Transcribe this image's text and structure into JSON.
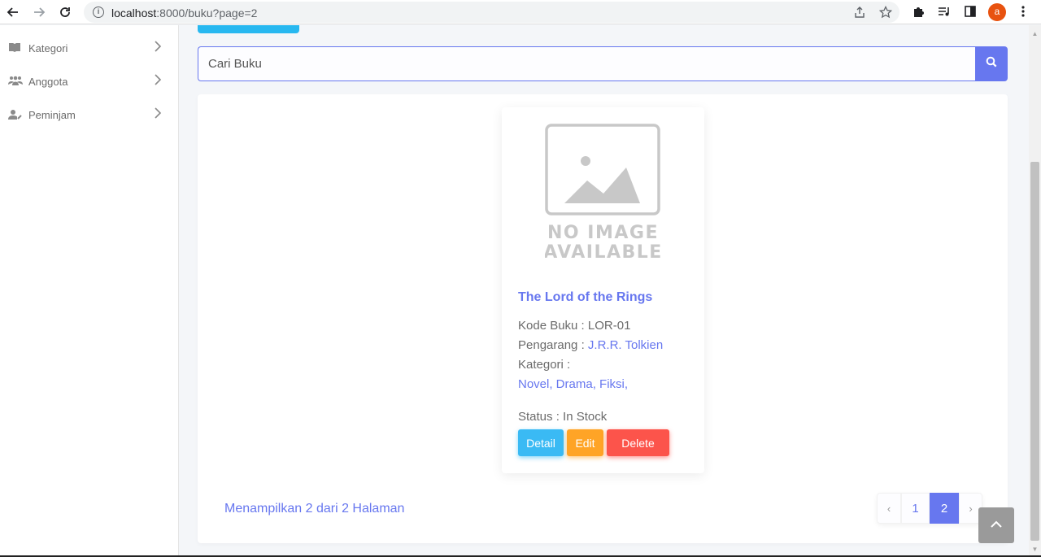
{
  "browser": {
    "url_host": "localhost",
    "url_path": ":8000/buku?page=2",
    "avatar_letter": "a"
  },
  "sidebar": {
    "items": [
      {
        "label": "Kategori",
        "icon": "book-open-icon"
      },
      {
        "label": "Anggota",
        "icon": "users-icon"
      },
      {
        "label": "Peminjam",
        "icon": "user-edit-icon"
      }
    ]
  },
  "search": {
    "placeholder": "Cari Buku",
    "value": ""
  },
  "book": {
    "image_text_1": "NO IMAGE",
    "image_text_2": "AVAILABLE",
    "title": "The Lord of the Rings",
    "code_label": "Kode Buku : ",
    "code": "LOR-01",
    "author_label": "Pengarang : ",
    "author": "J.R.R. Tolkien",
    "category_label": "Kategori :",
    "categories": "Novel, Drama, Fiksi,",
    "status_label": "Status : ",
    "status": "In Stock",
    "buttons": {
      "detail": "Detail",
      "edit": "Edit",
      "delete": "Delete"
    }
  },
  "pagination": {
    "info": "Menampilkan 2 dari 2 Halaman",
    "prev": "‹",
    "pages": [
      "1",
      "2"
    ],
    "current": "2",
    "next": "›"
  },
  "colors": {
    "primary": "#6777ef",
    "info": "#3abaf4",
    "warning": "#ffa426",
    "danger": "#fc544b"
  }
}
